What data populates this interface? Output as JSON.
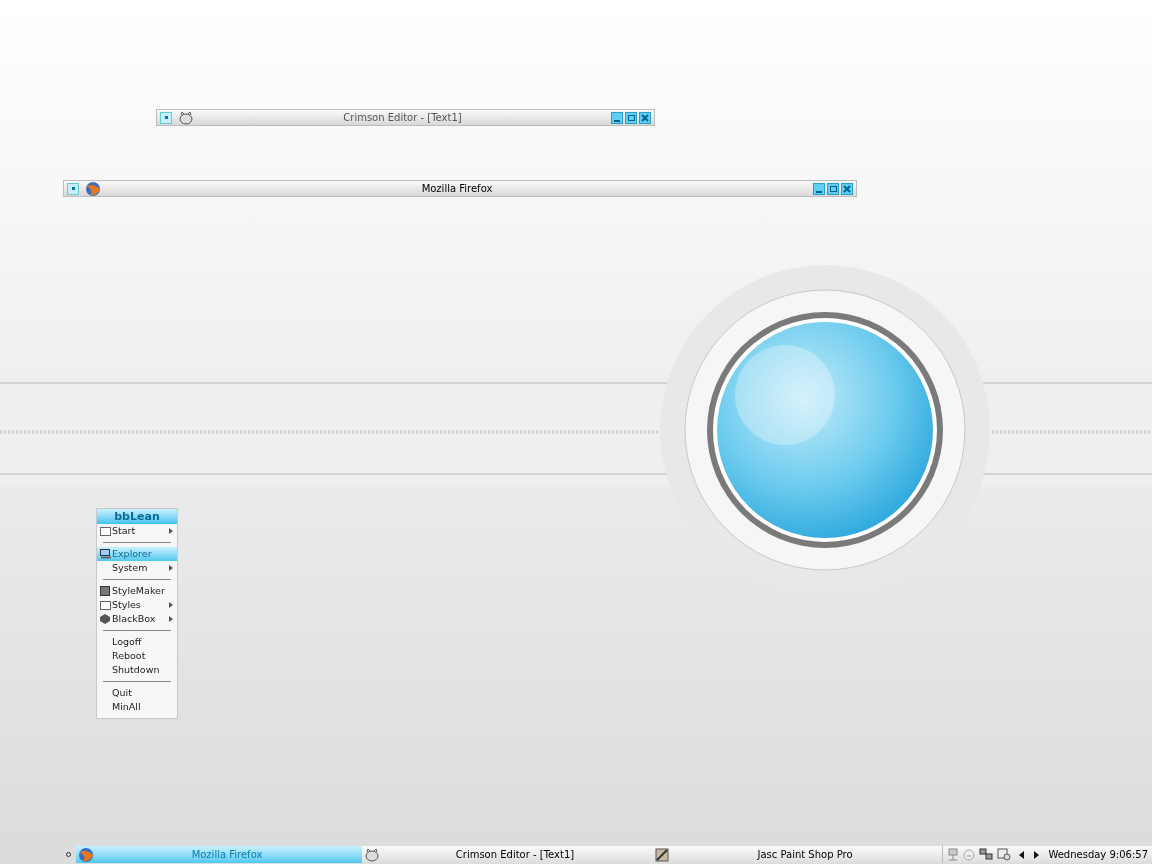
{
  "windows": [
    {
      "title": "Crimson Editor - [Text1]"
    },
    {
      "title": "Mozilla Firefox"
    }
  ],
  "menu": {
    "title": "bbLean",
    "items": [
      {
        "kind": "submenu",
        "label": "Start",
        "selected": false
      },
      {
        "kind": "separator"
      },
      {
        "kind": "command",
        "label": "Explorer",
        "selected": true
      },
      {
        "kind": "submenu",
        "label": "System",
        "selected": false
      },
      {
        "kind": "separator"
      },
      {
        "kind": "command",
        "label": "StyleMaker",
        "selected": false
      },
      {
        "kind": "submenu",
        "label": "Styles",
        "selected": false
      },
      {
        "kind": "submenu",
        "label": "BlackBox",
        "selected": false
      },
      {
        "kind": "separator"
      },
      {
        "kind": "command",
        "label": "Logoff",
        "selected": false
      },
      {
        "kind": "command",
        "label": "Reboot",
        "selected": false
      },
      {
        "kind": "command",
        "label": "Shutdown",
        "selected": false
      },
      {
        "kind": "separator"
      },
      {
        "kind": "command",
        "label": "Quit",
        "selected": false
      },
      {
        "kind": "command",
        "label": "MinAll",
        "selected": false
      }
    ]
  },
  "taskbar": {
    "tasks": [
      {
        "title": "Mozilla Firefox",
        "selected": true
      },
      {
        "title": "Crimson Editor - [Text1]",
        "selected": false
      },
      {
        "title": "Jasc Paint Shop Pro",
        "selected": false
      }
    ],
    "clock": "Wednesday 9:06:57"
  }
}
